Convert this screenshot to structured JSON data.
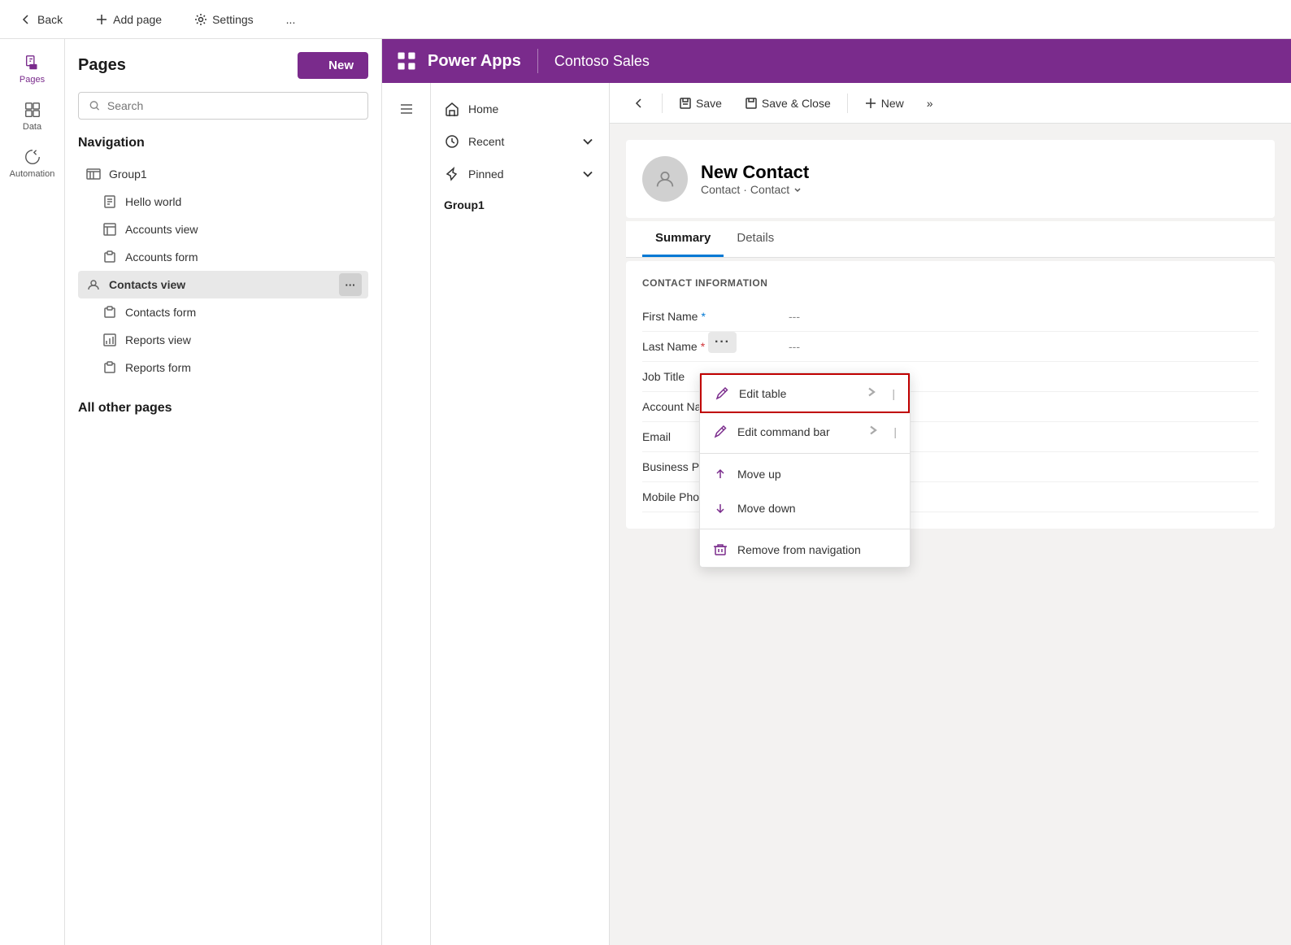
{
  "topBar": {
    "back_label": "Back",
    "add_page_label": "Add page",
    "settings_label": "Settings",
    "more_label": "..."
  },
  "iconSidebar": {
    "items": [
      {
        "id": "pages",
        "label": "Pages",
        "active": true
      },
      {
        "id": "data",
        "label": "Data",
        "active": false
      },
      {
        "id": "automation",
        "label": "Automation",
        "active": false
      }
    ]
  },
  "pagesPanel": {
    "title": "Pages",
    "new_button": "New",
    "search_placeholder": "Search",
    "navigation_title": "Navigation",
    "nav_items": [
      {
        "id": "group1",
        "label": "Group1",
        "type": "group",
        "level": 0
      },
      {
        "id": "hello-world",
        "label": "Hello world",
        "type": "page",
        "level": 1
      },
      {
        "id": "accounts-view",
        "label": "Accounts view",
        "type": "view",
        "level": 1
      },
      {
        "id": "accounts-form",
        "label": "Accounts form",
        "type": "form",
        "level": 1
      },
      {
        "id": "contacts-view",
        "label": "Contacts view",
        "type": "view",
        "level": 0,
        "active": true
      },
      {
        "id": "contacts-form",
        "label": "Contacts form",
        "type": "form",
        "level": 1
      },
      {
        "id": "reports-view",
        "label": "Reports view",
        "type": "view",
        "level": 1
      },
      {
        "id": "reports-form",
        "label": "Reports form",
        "type": "form",
        "level": 1
      }
    ],
    "all_other_pages": "All other pages"
  },
  "powerAppsHeader": {
    "logo_label": "Power Apps",
    "app_name": "Contoso Sales"
  },
  "appNav": {
    "items": [
      {
        "id": "home",
        "label": "Home"
      },
      {
        "id": "recent",
        "label": "Recent",
        "hasChevron": true
      },
      {
        "id": "pinned",
        "label": "Pinned",
        "hasChevron": true
      }
    ],
    "group_label": "Group1"
  },
  "toolbar": {
    "back_label": "Back",
    "save_label": "Save",
    "save_close_label": "Save & Close",
    "new_label": "New",
    "more_label": "»"
  },
  "contactForm": {
    "name": "New Contact",
    "subtitle1": "Contact",
    "subtitle2": "Contact",
    "tabs": [
      "Summary",
      "Details"
    ],
    "active_tab": "Summary",
    "section_title": "CONTACT INFORMATION",
    "fields": [
      {
        "label": "First Name",
        "value": "---",
        "required": "blue"
      },
      {
        "label": "Last Name",
        "value": "---",
        "required": "red"
      },
      {
        "label": "Job Title",
        "value": "---",
        "required": ""
      },
      {
        "label": "Account Name",
        "value": "---",
        "required": ""
      },
      {
        "label": "Email",
        "value": "---",
        "required": ""
      },
      {
        "label": "Business Phone",
        "value": "---",
        "required": ""
      },
      {
        "label": "Mobile Phone",
        "value": "---",
        "required": ""
      }
    ]
  },
  "contextMenu": {
    "items": [
      {
        "id": "edit-table",
        "label": "Edit table",
        "hasSubmenu": true,
        "highlighted": true
      },
      {
        "id": "edit-command-bar",
        "label": "Edit command bar",
        "hasSubmenu": true,
        "highlighted": false
      },
      {
        "id": "move-up",
        "label": "Move up",
        "hasSubmenu": false,
        "highlighted": false
      },
      {
        "id": "move-down",
        "label": "Move down",
        "hasSubmenu": false,
        "highlighted": false
      },
      {
        "id": "remove",
        "label": "Remove from navigation",
        "hasSubmenu": false,
        "highlighted": false
      }
    ]
  }
}
